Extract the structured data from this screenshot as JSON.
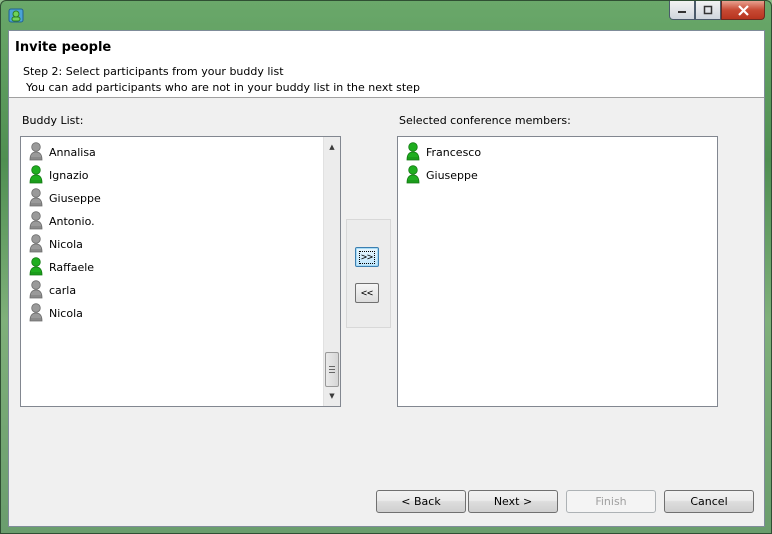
{
  "window": {
    "icon": "app-icon",
    "buttons": [
      "minimize",
      "maximize",
      "close"
    ]
  },
  "header": {
    "title": "Invite people",
    "step": "Step 2: Select participants from your buddy list",
    "description": "You can add participants who are not in your buddy list in the next step"
  },
  "buddy_list": {
    "label": "Buddy List:",
    "items": [
      {
        "name": "Annalisa",
        "status": "offline"
      },
      {
        "name": "Ignazio",
        "status": "online"
      },
      {
        "name": "Giuseppe",
        "status": "offline"
      },
      {
        "name": "Antonio.",
        "status": "offline"
      },
      {
        "name": "Nicola",
        "status": "offline"
      },
      {
        "name": "Raffaele",
        "status": "online"
      },
      {
        "name": "carla",
        "status": "offline"
      },
      {
        "name": "Nicola",
        "status": "offline"
      }
    ]
  },
  "selected": {
    "label": "Selected conference members:",
    "items": [
      {
        "name": "Francesco",
        "status": "online"
      },
      {
        "name": "Giuseppe",
        "status": "online"
      }
    ]
  },
  "move": {
    "add_label": ">>",
    "remove_label": "<<"
  },
  "buttons": {
    "back": "< Back",
    "next": "Next >",
    "finish": "Finish",
    "cancel": "Cancel"
  },
  "colors": {
    "online": "#1fae1f",
    "offline": "#9a9a9a"
  }
}
